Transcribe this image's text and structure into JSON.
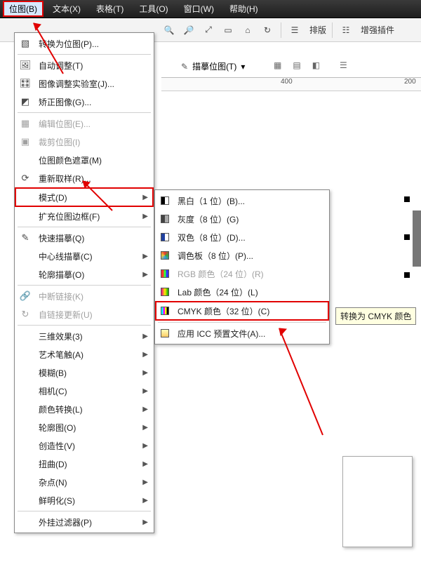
{
  "menubar": {
    "bitmap": "位图(B)",
    "text": "文本(X)",
    "table": "表格(T)",
    "tools": "工具(O)",
    "window": "窗口(W)",
    "help": "帮助(H)"
  },
  "toolbar_top": {
    "layout_label": "排版",
    "enhance_label": "增强插件"
  },
  "toolbar2": {
    "trace_label": "描摹位图(T)"
  },
  "ruler": {
    "t1": "400",
    "t2": "200"
  },
  "dropdown": {
    "convert": "转换为位图(P)...",
    "auto_adjust": "自动调整(T)",
    "image_lab": "图像调整实验室(J)...",
    "straighten": "矫正图像(G)...",
    "edit_bitmap": "编辑位图(E)...",
    "crop_bitmap": "裁剪位图(I)",
    "color_mask": "位图颜色遮罩(M)",
    "resample": "重新取样(R)...",
    "mode": "模式(D)",
    "inflate": "扩充位图边框(F)",
    "quick_trace": "快速描摹(Q)",
    "centerline": "中心线描摹(C)",
    "outline_trace": "轮廓描摹(O)",
    "break_link": "中断链接(K)",
    "update_link": "自链接更新(U)",
    "three_d": "三维效果(3)",
    "art_strokes": "艺术笔触(A)",
    "blur": "模糊(B)",
    "camera": "相机(C)",
    "color_trans": "颜色转换(L)",
    "contour": "轮廓图(O)",
    "creative": "创造性(V)",
    "distort": "扭曲(D)",
    "noise": "杂点(N)",
    "sharpen": "鲜明化(S)",
    "plugins": "外挂过滤器(P)"
  },
  "submenu": {
    "bw": "黑白（1 位）(B)...",
    "gray": "灰度（8 位）(G)",
    "duotone": "双色（8 位）(D)...",
    "paletted": "调色板（8 位）(P)...",
    "rgb": "RGB 颜色（24 位）(R)",
    "lab": "Lab 颜色（24 位）(L)",
    "cmyk": "CMYK 颜色（32 位）(C)",
    "icc": "应用 ICC 预置文件(A)..."
  },
  "tooltip": "转换为 CMYK 颜色",
  "chart_data": null
}
